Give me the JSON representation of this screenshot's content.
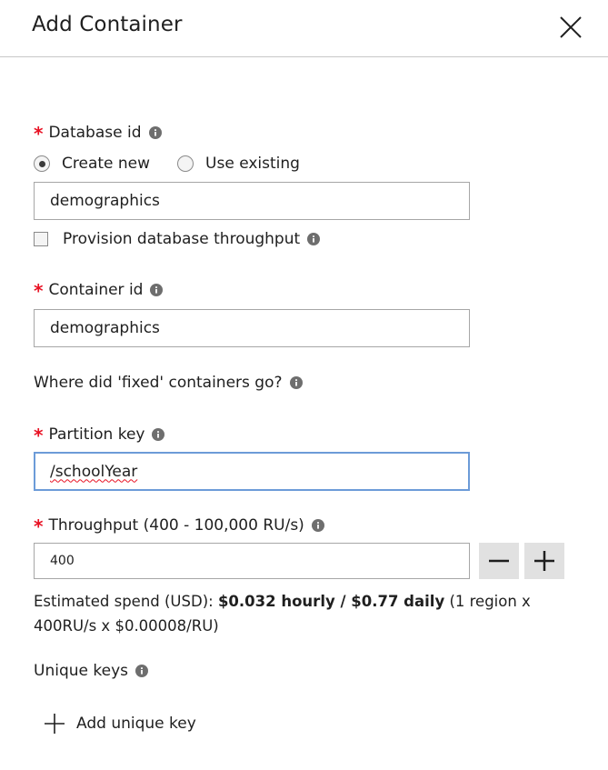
{
  "header": {
    "title": "Add Container",
    "close_icon": "close-icon"
  },
  "database": {
    "label": "Database id",
    "required_mark": "*",
    "radio_options": [
      {
        "label": "Create new",
        "checked": true
      },
      {
        "label": "Use existing",
        "checked": false
      }
    ],
    "value": "demographics",
    "provision_label": "Provision database throughput",
    "provision_checked": false
  },
  "container": {
    "label": "Container id",
    "required_mark": "*",
    "value": "demographics"
  },
  "fixed_link": {
    "label": "Where did 'fixed' containers go?"
  },
  "partition": {
    "label": "Partition key",
    "required_mark": "*",
    "value": "/schoolYear"
  },
  "throughput": {
    "label": "Throughput (400 - 100,000 RU/s)",
    "required_mark": "*",
    "value": "400",
    "decrement_icon": "minus-icon",
    "increment_icon": "plus-icon"
  },
  "estimate": {
    "prefix": "Estimated spend (USD): ",
    "bold": "$0.032 hourly / $0.77 daily",
    "suffix": " (1 region x 400RU/s x $0.00008/RU)"
  },
  "unique_keys": {
    "label": "Unique keys",
    "add_label": "Add unique key"
  },
  "colors": {
    "required": "#e81123",
    "focus_border": "#6c9bd8",
    "stepper_bg": "#e1e1e1"
  }
}
